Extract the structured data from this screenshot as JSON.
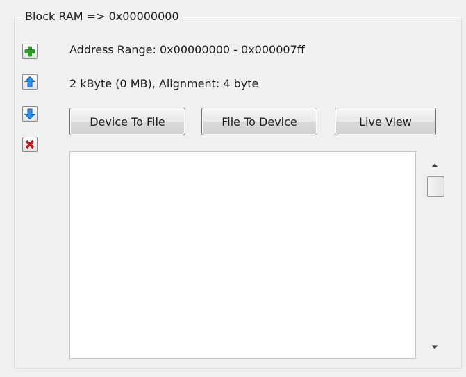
{
  "group": {
    "title": "Block RAM => 0x00000000"
  },
  "side_toolbar": [
    {
      "name": "add-block-button",
      "icon": "plus-icon",
      "color": "#2aa02a"
    },
    {
      "name": "move-up-button",
      "icon": "arrow-up-icon",
      "color": "#1e7fd8"
    },
    {
      "name": "move-down-button",
      "icon": "arrow-down-icon",
      "color": "#1e7fd8"
    },
    {
      "name": "remove-block-button",
      "icon": "delete-x-icon",
      "color": "#d42020"
    }
  ],
  "info": {
    "address_range": "Address Range: 0x00000000 - 0x000007ff",
    "size_alignment": "2 kByte (0 MB), Alignment: 4 byte"
  },
  "buttons": {
    "device_to_file": "Device To File",
    "file_to_device": "File To Device",
    "live_view": "Live View"
  },
  "listbox": {
    "items": []
  },
  "scrollbar": {
    "up_icon": "scroll-up-arrow-icon",
    "down_icon": "scroll-down-arrow-icon"
  }
}
